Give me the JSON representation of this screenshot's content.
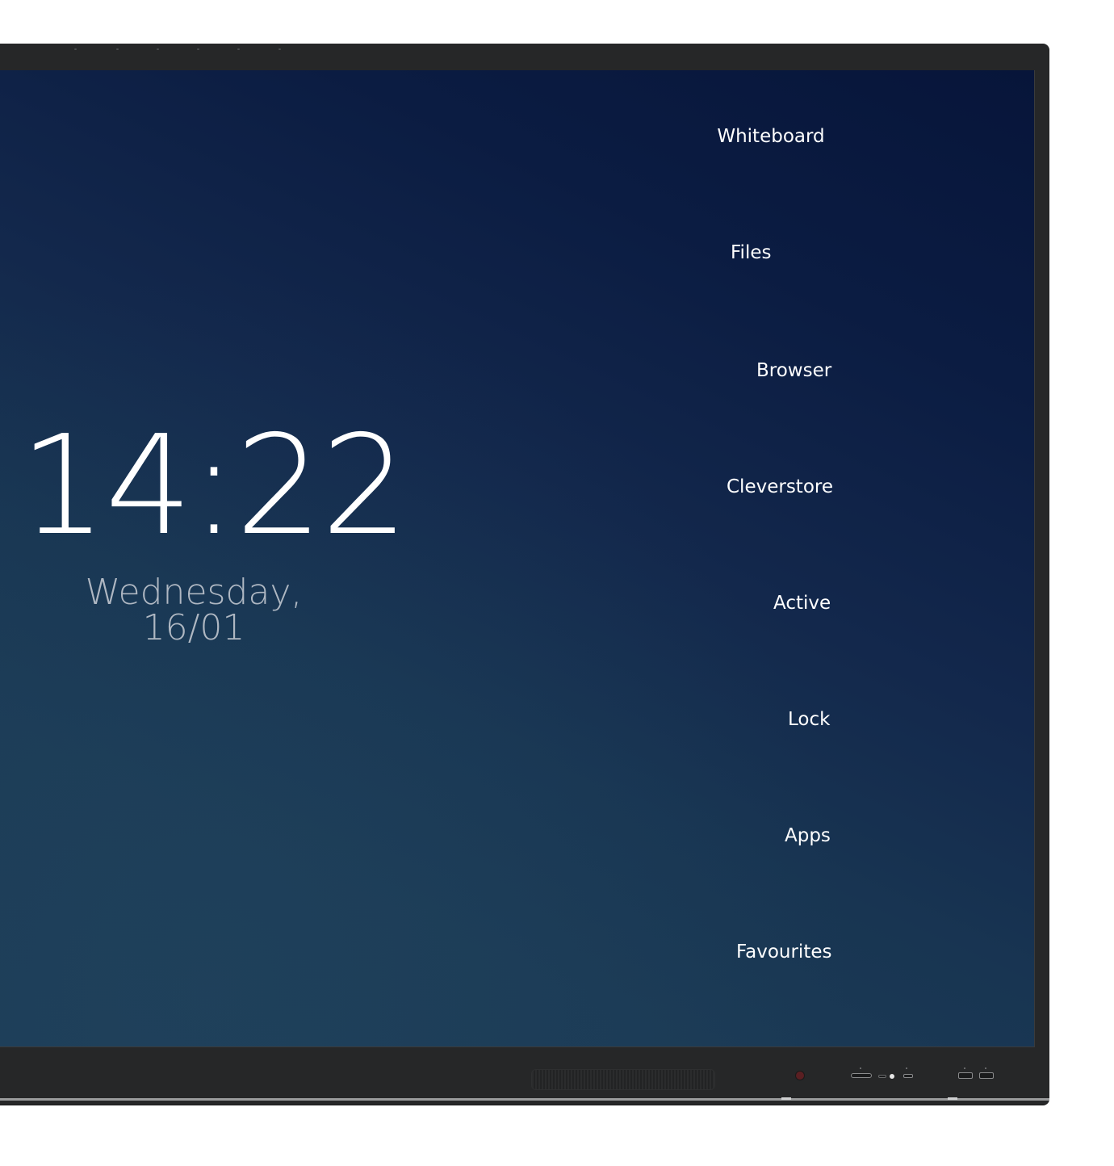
{
  "clock": {
    "time": "14:22",
    "date": "Wednesday,  16/01"
  },
  "menu": {
    "items": [
      {
        "label": "Whiteboard"
      },
      {
        "label": "Files"
      },
      {
        "label": "Browser"
      },
      {
        "label": "Cleverstore"
      },
      {
        "label": "Active"
      },
      {
        "label": "Lock"
      },
      {
        "label": "Apps"
      },
      {
        "label": "Favourites"
      }
    ]
  },
  "colors": {
    "bezel": "#262728",
    "screen_top": "#07153a",
    "screen_bottom": "#1c3b56",
    "text": "#ffffff"
  }
}
